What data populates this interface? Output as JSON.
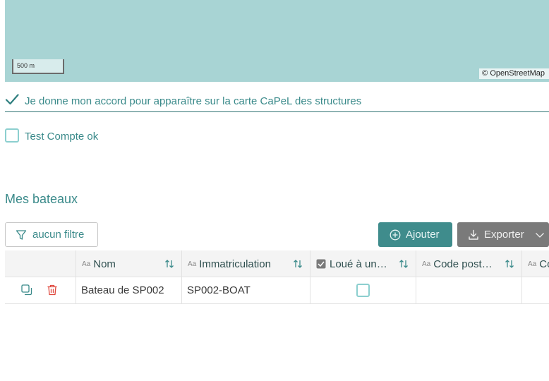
{
  "map": {
    "scale_label": "500 m",
    "attribution": "© OpenStreetMap",
    "background_color": "#a8d4d4"
  },
  "consent": {
    "label": "Je donne mon accord pour apparaître sur la carte CaPeL des structures",
    "checked": true
  },
  "test_account": {
    "label": "Test Compte ok",
    "checked": false
  },
  "section": {
    "title": "Mes bateaux"
  },
  "toolbar": {
    "filter_label": "aucun filtre",
    "add_label": "Ajouter",
    "export_label": "Exporter"
  },
  "table": {
    "columns": [
      {
        "label": "Nom",
        "type_icon": "text-type-icon"
      },
      {
        "label": "Immatriculation",
        "type_icon": "text-type-icon"
      },
      {
        "label": "Loué à un…",
        "type_icon": "checkbox-type-icon"
      },
      {
        "label": "Code post…",
        "type_icon": "text-type-icon"
      },
      {
        "label": "Co",
        "type_icon": "text-type-icon"
      }
    ],
    "rows": [
      {
        "nom": "Bateau de SP002",
        "immatriculation": "SP002-BOAT",
        "loue": false,
        "code_postal": "",
        "extra": ""
      }
    ]
  },
  "colors": {
    "accent": "#3f8c8c",
    "export_button": "#7a7a7a",
    "delete": "#e0483e"
  }
}
